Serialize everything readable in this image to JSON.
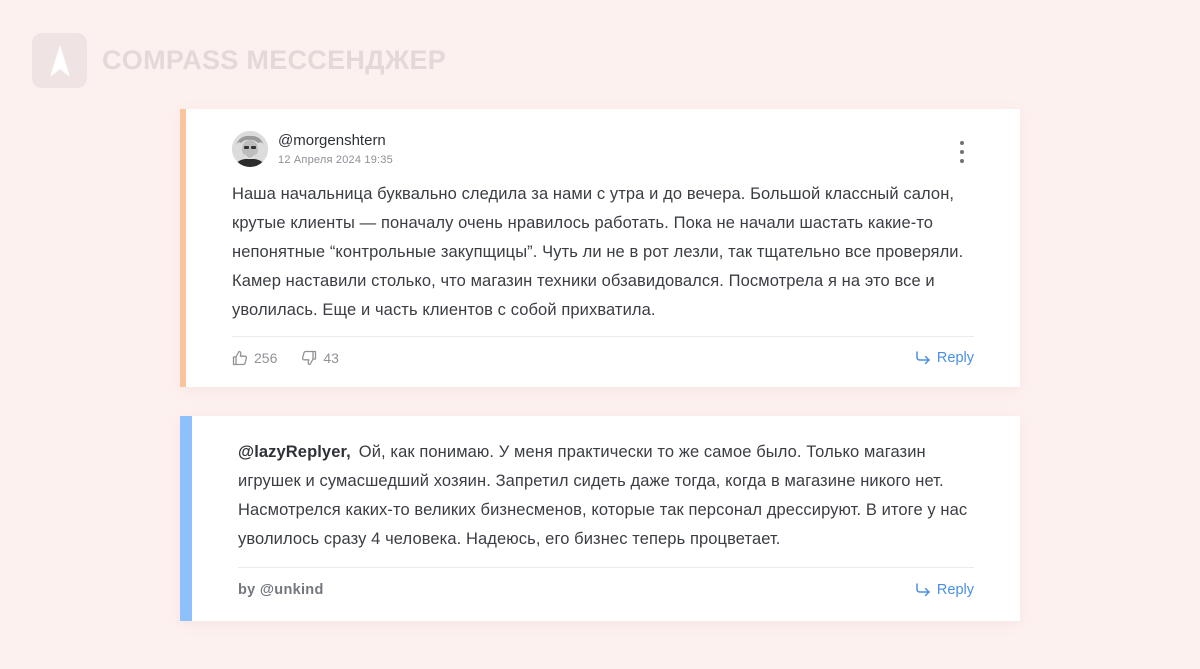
{
  "brand": {
    "name": "COMPASS МЕССЕНДЖЕР",
    "logo_icon": "compass-arrow-icon"
  },
  "comment": {
    "username": "@morgenshtern",
    "timestamp": "12 Апреля 2024 19:35",
    "text": "Наша начальница буквально следила за нами с утра и до вечера. Большой классный салон, крутые клиенты — поначалу очень нравилось работать. Пока не начали шастать какие-то непонятные “контрольные закупщицы”. Чуть ли не в рот лезли, так тщательно все проверяли. Камер наставили столько, что магазин техники обзавидовался. Посмотрела я на это все и уволилась. Еще и часть клиентов с собой прихватила.",
    "likes": "256",
    "dislikes": "43",
    "reply_label": "Reply",
    "accent_color": "#f8c59c"
  },
  "reply": {
    "mention": "@lazyReplyer,",
    "text": "Ой, как понимаю. У меня практически то же самое было. Только магазин игрушек и сумасшедший хозяин. Запретил сидеть даже тогда, когда в магазине никого нет. Насмотрелся каких-то великих бизнесменов, которые так персонал дрессируют. В итоге у нас уволилось сразу 4 человека. Надеюсь, его бизнес теперь процветает.",
    "by": "by @unkind",
    "reply_label": "Reply",
    "accent_color": "#8ec0fb"
  }
}
